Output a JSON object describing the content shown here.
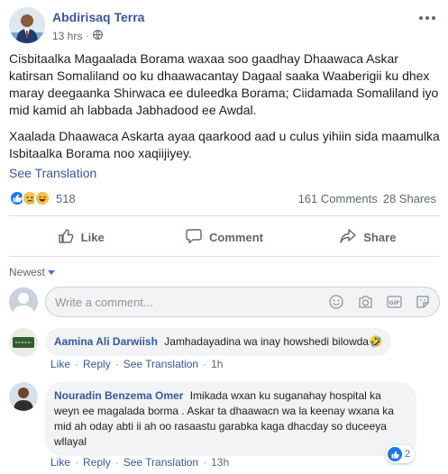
{
  "post": {
    "author": "Abdirisaq Terra",
    "time": "13 hrs",
    "privacy_icon": "globe-icon",
    "paragraphs": [
      "Cisbitaalka Magaalada Borama waxaa soo gaadhay Dhaawaca Askar katirsan Somaliland oo ku dhaawacantay Dagaal saaka Waaberigii ku dhex maray deegaanka Shirwaca ee duleedka Borama; Ciidamada Somaliland iyo mid kamid ah labbada Jabhadood ee Awdal.",
      "Xaalada Dhaawaca Askarta ayaa qaarkood aad u culus yihiin sida maamulka Isbitaalka Borama noo xaqiijiyey."
    ],
    "see_translation": "See Translation"
  },
  "stats": {
    "reactions": [
      "like-icon",
      "sad-icon",
      "haha-icon"
    ],
    "reaction_count": "518",
    "comments": "161 Comments",
    "shares": "28 Shares"
  },
  "actions": {
    "like": "Like",
    "comment": "Comment",
    "share": "Share"
  },
  "sort": {
    "label": "Newest"
  },
  "composer": {
    "placeholder": "Write a comment...",
    "icons": [
      "emoji-icon",
      "camera-icon",
      "gif-icon",
      "sticker-icon"
    ]
  },
  "comments": [
    {
      "name": "Aamina Ali Darwiish",
      "text": "Jamhadayadina wa inay howshedi bilowda🤣",
      "like": "Like",
      "reply": "Reply",
      "see_translation": "See Translation",
      "time": "1h"
    },
    {
      "name": "Nouradin Benzema Omer",
      "text": "Imikada wxan ku suganahay hospital ka weyn ee magalada borma . Askar ta dhaawacn wa la keenay wxana ka mid ah oday abti ii ah oo rasaastu garabka kaga dhacday so duceeya wllayal",
      "like": "Like",
      "reply": "Reply",
      "see_translation": "See Translation",
      "time": "13h",
      "reaction_count": "2"
    }
  ],
  "colors": {
    "link": "#385898",
    "muted": "#606770",
    "like_blue": "#1877f2",
    "bubble": "#f2f3f5"
  }
}
